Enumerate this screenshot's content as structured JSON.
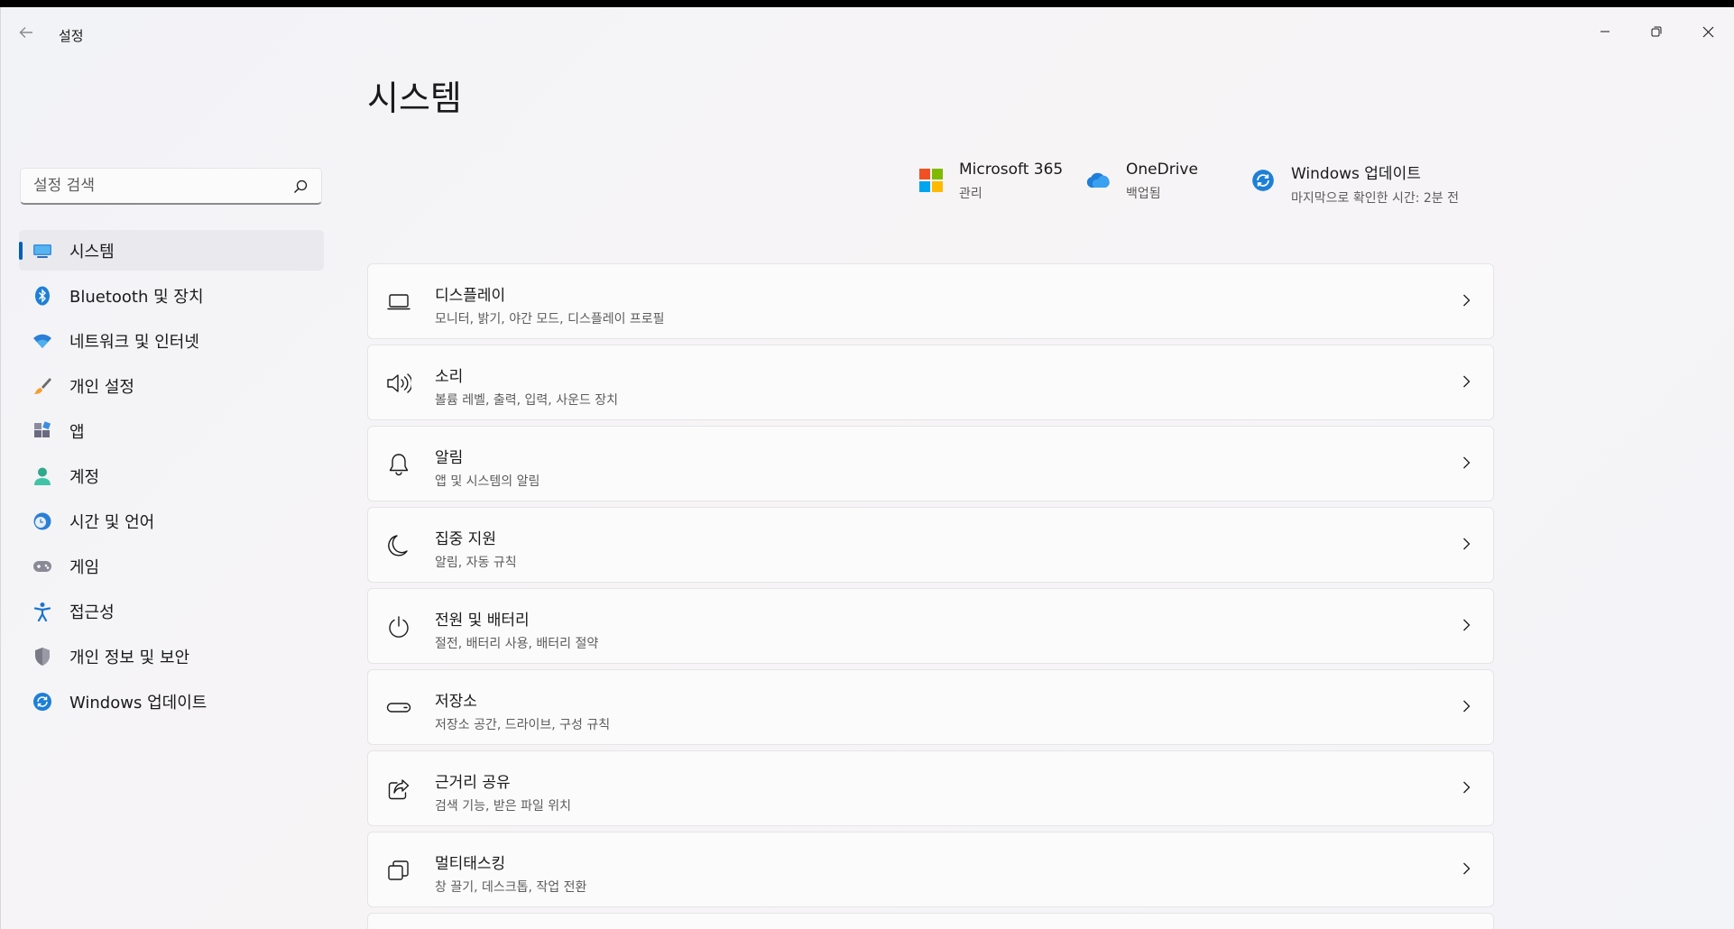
{
  "window": {
    "title": "설정"
  },
  "page": {
    "title": "시스템"
  },
  "search": {
    "placeholder": "설정 검색"
  },
  "sidebar": {
    "items": [
      {
        "label": "시스템",
        "icon": "system-icon",
        "active": true
      },
      {
        "label": "Bluetooth 및 장치",
        "icon": "bluetooth-icon"
      },
      {
        "label": "네트워크 및 인터넷",
        "icon": "wifi-icon"
      },
      {
        "label": "개인 설정",
        "icon": "brush-icon"
      },
      {
        "label": "앱",
        "icon": "apps-icon"
      },
      {
        "label": "계정",
        "icon": "account-icon"
      },
      {
        "label": "시간 및 언어",
        "icon": "time-language-icon"
      },
      {
        "label": "게임",
        "icon": "gamepad-icon"
      },
      {
        "label": "접근성",
        "icon": "accessibility-icon"
      },
      {
        "label": "개인 정보 및 보안",
        "icon": "shield-icon"
      },
      {
        "label": "Windows 업데이트",
        "icon": "update-icon"
      }
    ]
  },
  "quick_links": [
    {
      "title": "Microsoft 365",
      "subtitle": "관리",
      "icon": "microsoft-logo-icon"
    },
    {
      "title": "OneDrive",
      "subtitle": "백업됨",
      "icon": "cloud-icon"
    },
    {
      "title": "Windows 업데이트",
      "subtitle": "마지막으로 확인한 시간: 2분 전",
      "icon": "update-icon"
    }
  ],
  "settings": [
    {
      "title": "디스플레이",
      "subtitle": "모니터, 밝기, 야간 모드, 디스플레이 프로필",
      "icon": "display-icon"
    },
    {
      "title": "소리",
      "subtitle": "볼륨 레벨, 출력, 입력, 사운드 장치",
      "icon": "speaker-icon"
    },
    {
      "title": "알림",
      "subtitle": "앱 및 시스템의 알림",
      "icon": "bell-icon"
    },
    {
      "title": "집중 지원",
      "subtitle": "알림, 자동 규칙",
      "icon": "moon-icon"
    },
    {
      "title": "전원 및 배터리",
      "subtitle": "절전, 배터리 사용, 배터리 절약",
      "icon": "power-icon"
    },
    {
      "title": "저장소",
      "subtitle": "저장소 공간, 드라이브, 구성 규칙",
      "icon": "storage-icon"
    },
    {
      "title": "근거리 공유",
      "subtitle": "검색 기능, 받은 파일 위치",
      "icon": "share-icon"
    },
    {
      "title": "멀티태스킹",
      "subtitle": "창 끌기, 데스크톱, 작업 전환",
      "icon": "multitask-icon"
    }
  ],
  "colors": {
    "accent": "#005fb8",
    "background": "#f3f3f3",
    "card": "#fbfbfb"
  }
}
